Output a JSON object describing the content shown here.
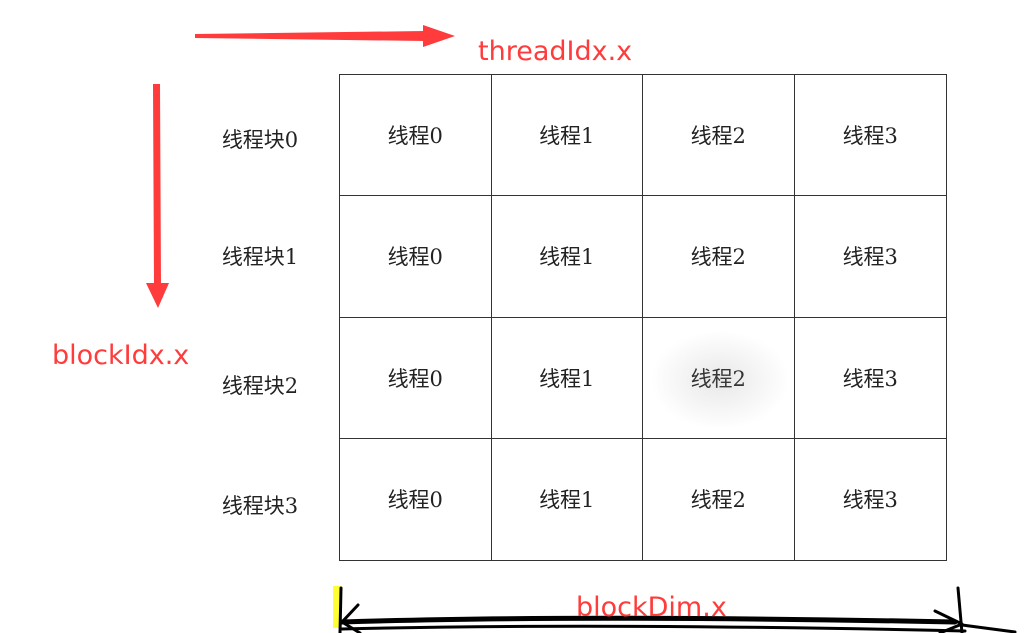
{
  "labels": {
    "thread_idx": "threadIdx.x",
    "block_idx": "blockIdx.x",
    "block_dim": "blockDim.x"
  },
  "rows": [
    {
      "label": "线程块0",
      "cells": [
        "线程0",
        "线程1",
        "线程2",
        "线程3"
      ]
    },
    {
      "label": "线程块1",
      "cells": [
        "线程0",
        "线程1",
        "线程2",
        "线程3"
      ]
    },
    {
      "label": "线程块2",
      "cells": [
        "线程0",
        "线程1",
        "线程2",
        "线程3"
      ]
    },
    {
      "label": "线程块3",
      "cells": [
        "线程0",
        "线程1",
        "线程2",
        "线程3"
      ]
    }
  ],
  "colors": {
    "arrow_red": "#ff3b3b",
    "grid_line": "#333333",
    "scribble": "#000000",
    "highlight": "#ffff33"
  }
}
